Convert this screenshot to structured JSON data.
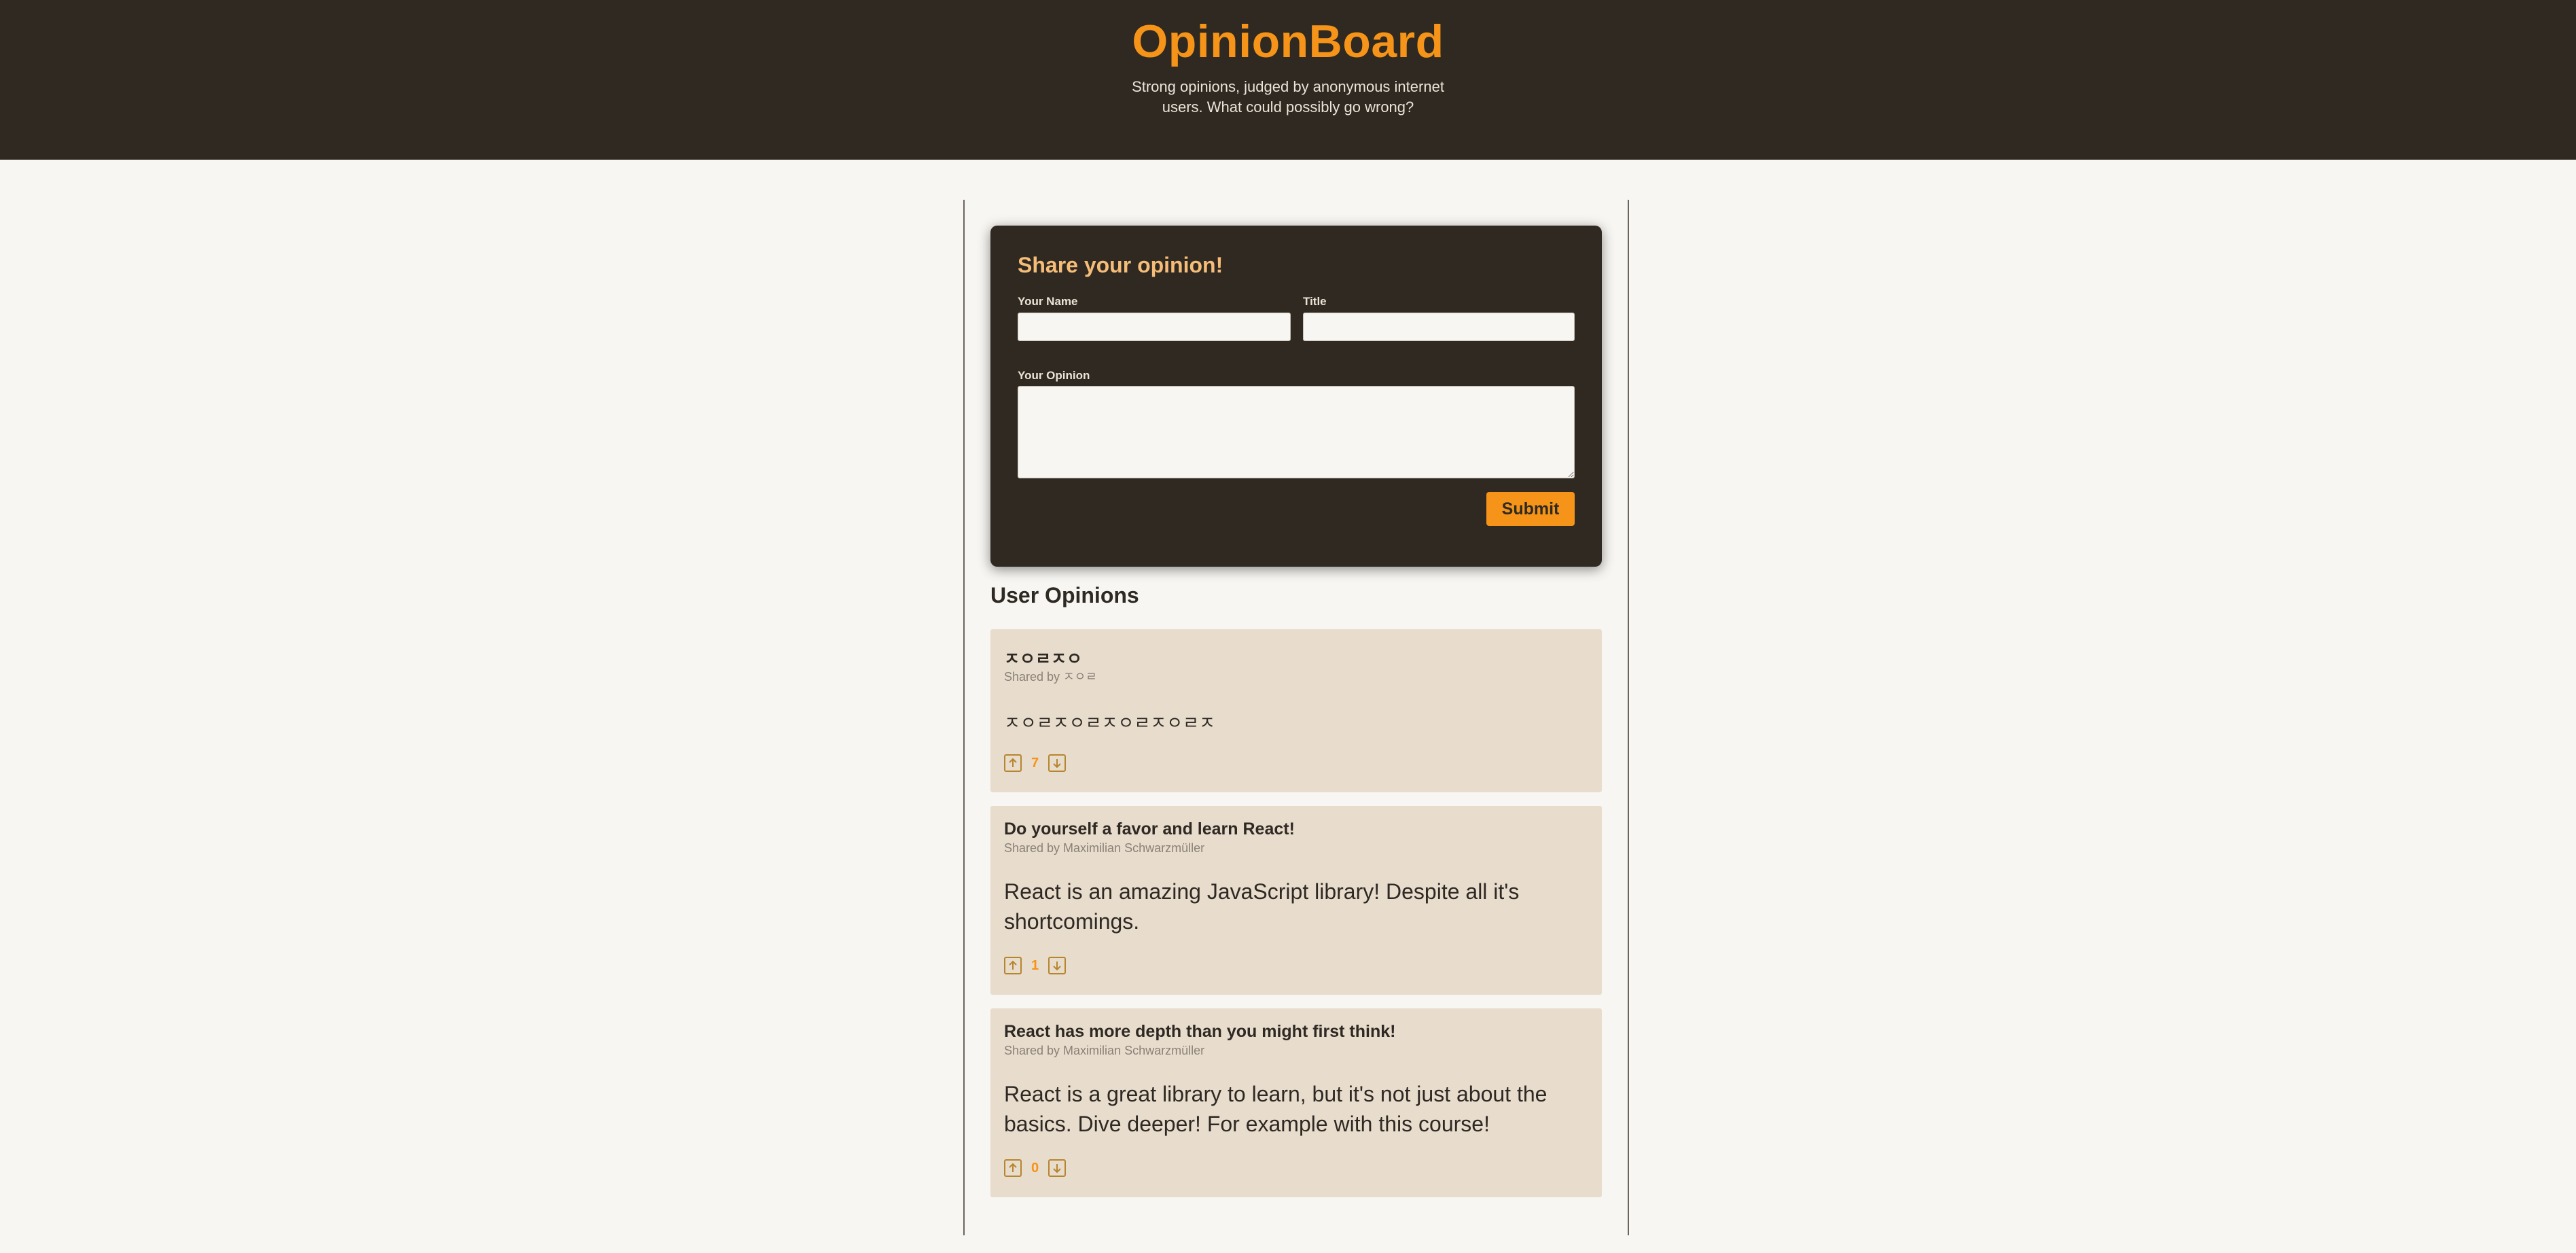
{
  "header": {
    "title": "OpinionBoard",
    "tagline": "Strong opinions, judged by anonymous internet users. What could possibly go wrong?"
  },
  "form": {
    "heading": "Share your opinion!",
    "name_label": "Your Name",
    "name_value": "",
    "title_label": "Title",
    "title_value": "",
    "opinion_label": "Your Opinion",
    "opinion_value": "",
    "submit_label": "Submit"
  },
  "opinions_section": {
    "heading": "User Opinions",
    "items": [
      {
        "title": "ㅈㅇㄹㅈㅇ",
        "author": "Shared by ㅈㅇㄹ",
        "body": "ㅈㅇㄹㅈㅇㄹㅈㅇㄹㅈㅇㄹㅈ",
        "votes": "7",
        "upvote_icon": "arrow-up-icon",
        "downvote_icon": "arrow-down-icon"
      },
      {
        "title": "Do yourself a favor and learn React!",
        "author": "Shared by Maximilian Schwarzmüller",
        "body": "React is an amazing JavaScript library! Despite all it's shortcomings.",
        "votes": "1",
        "upvote_icon": "arrow-up-icon",
        "downvote_icon": "arrow-down-icon"
      },
      {
        "title": "React has more depth than you might first think!",
        "author": "Shared by Maximilian Schwarzmüller",
        "body": "React is a great library to learn, but it's not just about the basics. Dive deeper! For example with this course!",
        "votes": "0",
        "upvote_icon": "arrow-up-icon",
        "downvote_icon": "arrow-down-icon"
      }
    ]
  },
  "colors": {
    "accent": "#f59418",
    "header_bg": "#2f2922",
    "card_bg": "#e8dccd",
    "page_bg": "#f8f6f2",
    "form_heading": "#f5bd78"
  }
}
